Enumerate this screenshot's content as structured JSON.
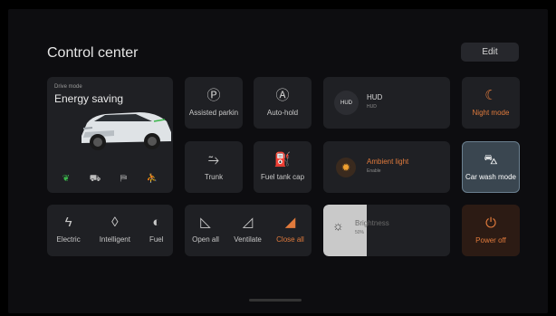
{
  "header": {
    "title": "Control center",
    "edit_label": "Edit"
  },
  "drive_mode": {
    "label": "Drive mode",
    "value": "Energy saving",
    "icons": [
      "leaf-icon",
      "car-icon",
      "road-icon",
      "person-seat-icon"
    ]
  },
  "tiles": {
    "assisted_parking": {
      "label": "Assisted parkin",
      "icon": "parking-icon"
    },
    "auto_hold": {
      "label": "Auto-hold",
      "icon": "auto-hold-icon"
    },
    "hud": {
      "badge": "HUD",
      "title": "HUD",
      "subtitle": "HUD"
    },
    "night_mode": {
      "label": "Night mode",
      "icon": "moon-icon",
      "color": "#e07a3c"
    },
    "trunk": {
      "label": "Trunk",
      "icon": "trunk-icon"
    },
    "fuel_tank_cap": {
      "label": "Fuel tank cap",
      "icon": "fuel-cap-icon"
    },
    "ambient_light": {
      "title": "Ambient light",
      "subtitle": "Enable",
      "icon": "sun-icon",
      "color": "#e07a3c"
    },
    "car_wash_mode": {
      "label": "Car wash mode",
      "icon": "car-wash-icon"
    },
    "power_modes": {
      "items": [
        {
          "label": "Electric",
          "icon": "lightning-icon"
        },
        {
          "label": "Intelligent",
          "icon": "drop-icon"
        },
        {
          "label": "Fuel",
          "icon": "fuel-toggle-icon"
        }
      ]
    },
    "windows": {
      "items": [
        {
          "label": "Open all",
          "icon": "window-open-icon"
        },
        {
          "label": "Ventilate",
          "icon": "window-vent-icon"
        },
        {
          "label": "Close all",
          "icon": "window-close-icon",
          "color": "#e07a3c"
        }
      ]
    },
    "brightness": {
      "title": "Brightness",
      "value": "50%",
      "level": 0.5
    },
    "power_off": {
      "label": "Power off",
      "icon": "power-icon",
      "color": "#e07a3c"
    }
  }
}
